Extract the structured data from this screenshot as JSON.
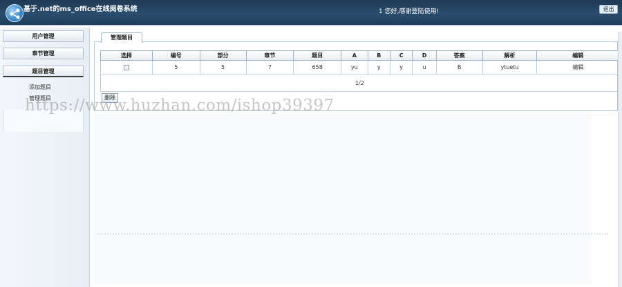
{
  "header": {
    "title": "基于.net的ms_office在线阅卷系统",
    "welcome": "1 您好,感谢登陆使用!",
    "logout_label": "退出"
  },
  "sidebar": {
    "items": [
      {
        "label": "用户管理"
      },
      {
        "label": "章节管理"
      },
      {
        "label": "题目管理"
      }
    ],
    "sub_items": [
      {
        "label": "添加题目"
      },
      {
        "label": "管理题目"
      }
    ]
  },
  "main": {
    "tab_label": "管理题目",
    "table": {
      "columns": [
        "选择",
        "编号",
        "部分",
        "章节",
        "题目",
        "A",
        "B",
        "C",
        "D",
        "答案",
        "解析",
        "编辑"
      ],
      "rows": [
        {
          "id": "5",
          "part": "5",
          "chapter": "7",
          "question": "658",
          "a": "yu",
          "b": "y",
          "c": "y",
          "d": "u",
          "answer": "B",
          "analysis": "ytuetu",
          "edit": "编辑"
        }
      ]
    },
    "pager": "1/2",
    "delete_label": "删除"
  },
  "watermark": "https://www.huzhan.com/ishop39397"
}
